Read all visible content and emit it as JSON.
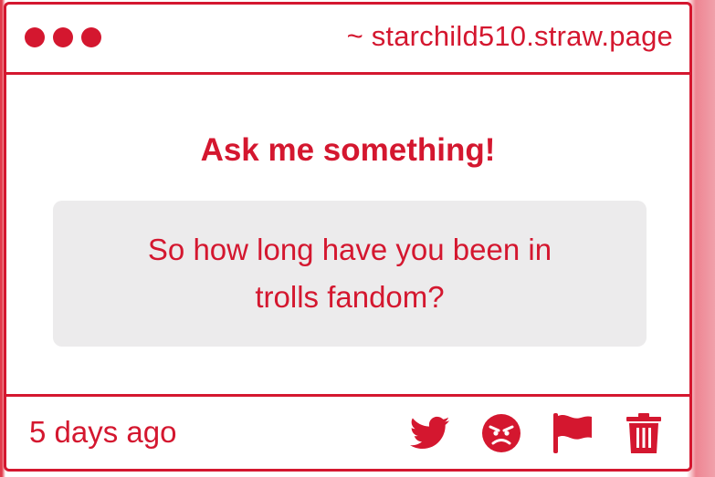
{
  "window": {
    "url": "~ starchild510.straw.page"
  },
  "main": {
    "heading": "Ask me something!",
    "question": "So how long have you been in trolls fandom?"
  },
  "footer": {
    "timestamp": "5 days ago",
    "actions": [
      {
        "icon": "twitter-icon"
      },
      {
        "icon": "angry-face-icon"
      },
      {
        "icon": "flag-icon"
      },
      {
        "icon": "trash-icon"
      }
    ]
  },
  "colors": {
    "accent": "#d4172f",
    "question_bg": "#ecebec"
  }
}
